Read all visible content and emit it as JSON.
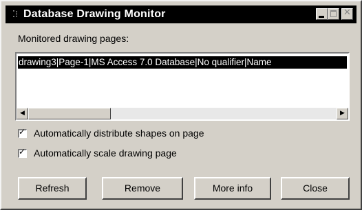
{
  "window": {
    "title": "Database Drawing Monitor",
    "icon": "app-icon"
  },
  "list": {
    "label": "Monitored drawing pages:",
    "items": [
      "drawing3|Page-1|MS Access 7.0 Database|No qualifier|Name"
    ]
  },
  "options": {
    "distribute_label": "Automatically distribute shapes on page",
    "distribute_checked": true,
    "scale_label": "Automatically scale drawing page",
    "scale_checked": true
  },
  "buttons": {
    "refresh": "Refresh",
    "remove": "Remove",
    "more_info": "More info",
    "close": "Close"
  },
  "glyphs": {
    "title_icon": "⁚⁝",
    "close_x": "✕",
    "check": "✓",
    "arrow_left": "◀",
    "arrow_right": "▶"
  }
}
